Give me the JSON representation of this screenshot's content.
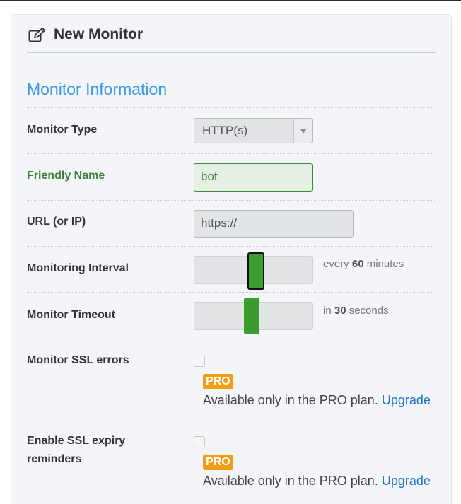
{
  "header": {
    "title": "New Monitor",
    "icon": "edit-icon"
  },
  "section": {
    "title": "Monitor Information"
  },
  "fields": {
    "monitor_type": {
      "label": "Monitor Type",
      "selected": "HTTP(s)"
    },
    "friendly_name": {
      "label": "Friendly Name",
      "value": "bot"
    },
    "url": {
      "label": "URL (or IP)",
      "value": "https://"
    },
    "interval": {
      "label": "Monitoring Interval",
      "note_prefix": "every",
      "value": "60",
      "note_suffix": "minutes"
    },
    "timeout": {
      "label": "Monitor Timeout",
      "note_prefix": "in",
      "value": "30",
      "note_suffix": "seconds"
    },
    "ssl_errors": {
      "label": "Monitor SSL errors",
      "badge": "PRO",
      "note": "Available only in the PRO plan.",
      "link": "Upgrade"
    },
    "ssl_expiry": {
      "label_line1": "Enable SSL expiry",
      "label_line2": "reminders",
      "badge": "PRO",
      "note": "Available only in the PRO plan.",
      "link": "Upgrade"
    }
  },
  "colors": {
    "accent": "#3a9ae8",
    "valid": "#3b7f3b",
    "slider_handle": "#3c9a2e",
    "pro_badge": "#f29d12",
    "link": "#1a73c8"
  }
}
